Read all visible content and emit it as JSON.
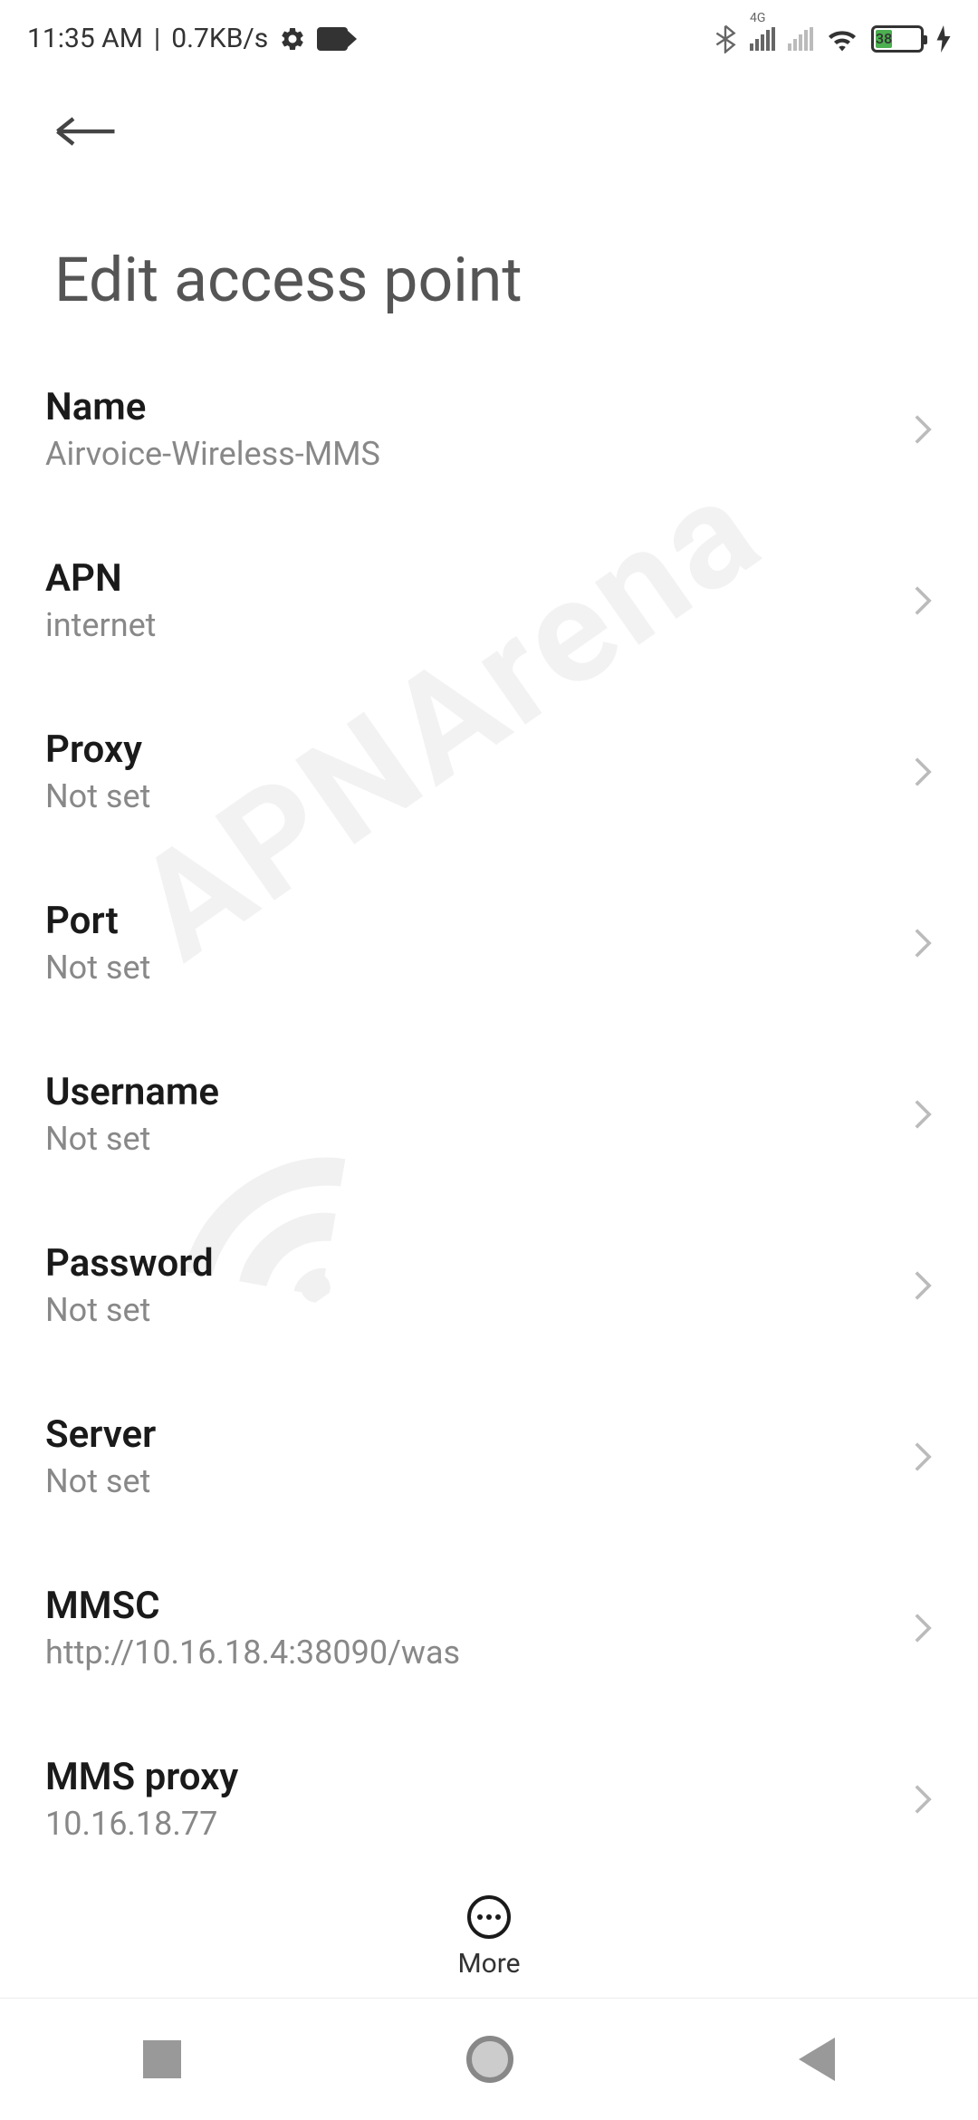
{
  "status_bar": {
    "time": "11:35 AM",
    "data_rate": "0.7KB/s",
    "network_label": "4G",
    "battery_pct": "38"
  },
  "page": {
    "title": "Edit access point"
  },
  "settings": [
    {
      "label": "Name",
      "value": "Airvoice-Wireless-MMS"
    },
    {
      "label": "APN",
      "value": "internet"
    },
    {
      "label": "Proxy",
      "value": "Not set"
    },
    {
      "label": "Port",
      "value": "Not set"
    },
    {
      "label": "Username",
      "value": "Not set"
    },
    {
      "label": "Password",
      "value": "Not set"
    },
    {
      "label": "Server",
      "value": "Not set"
    },
    {
      "label": "MMSC",
      "value": "http://10.16.18.4:38090/was"
    },
    {
      "label": "MMS proxy",
      "value": "10.16.18.77"
    }
  ],
  "bottom": {
    "more_label": "More"
  },
  "watermark": "APNArena"
}
